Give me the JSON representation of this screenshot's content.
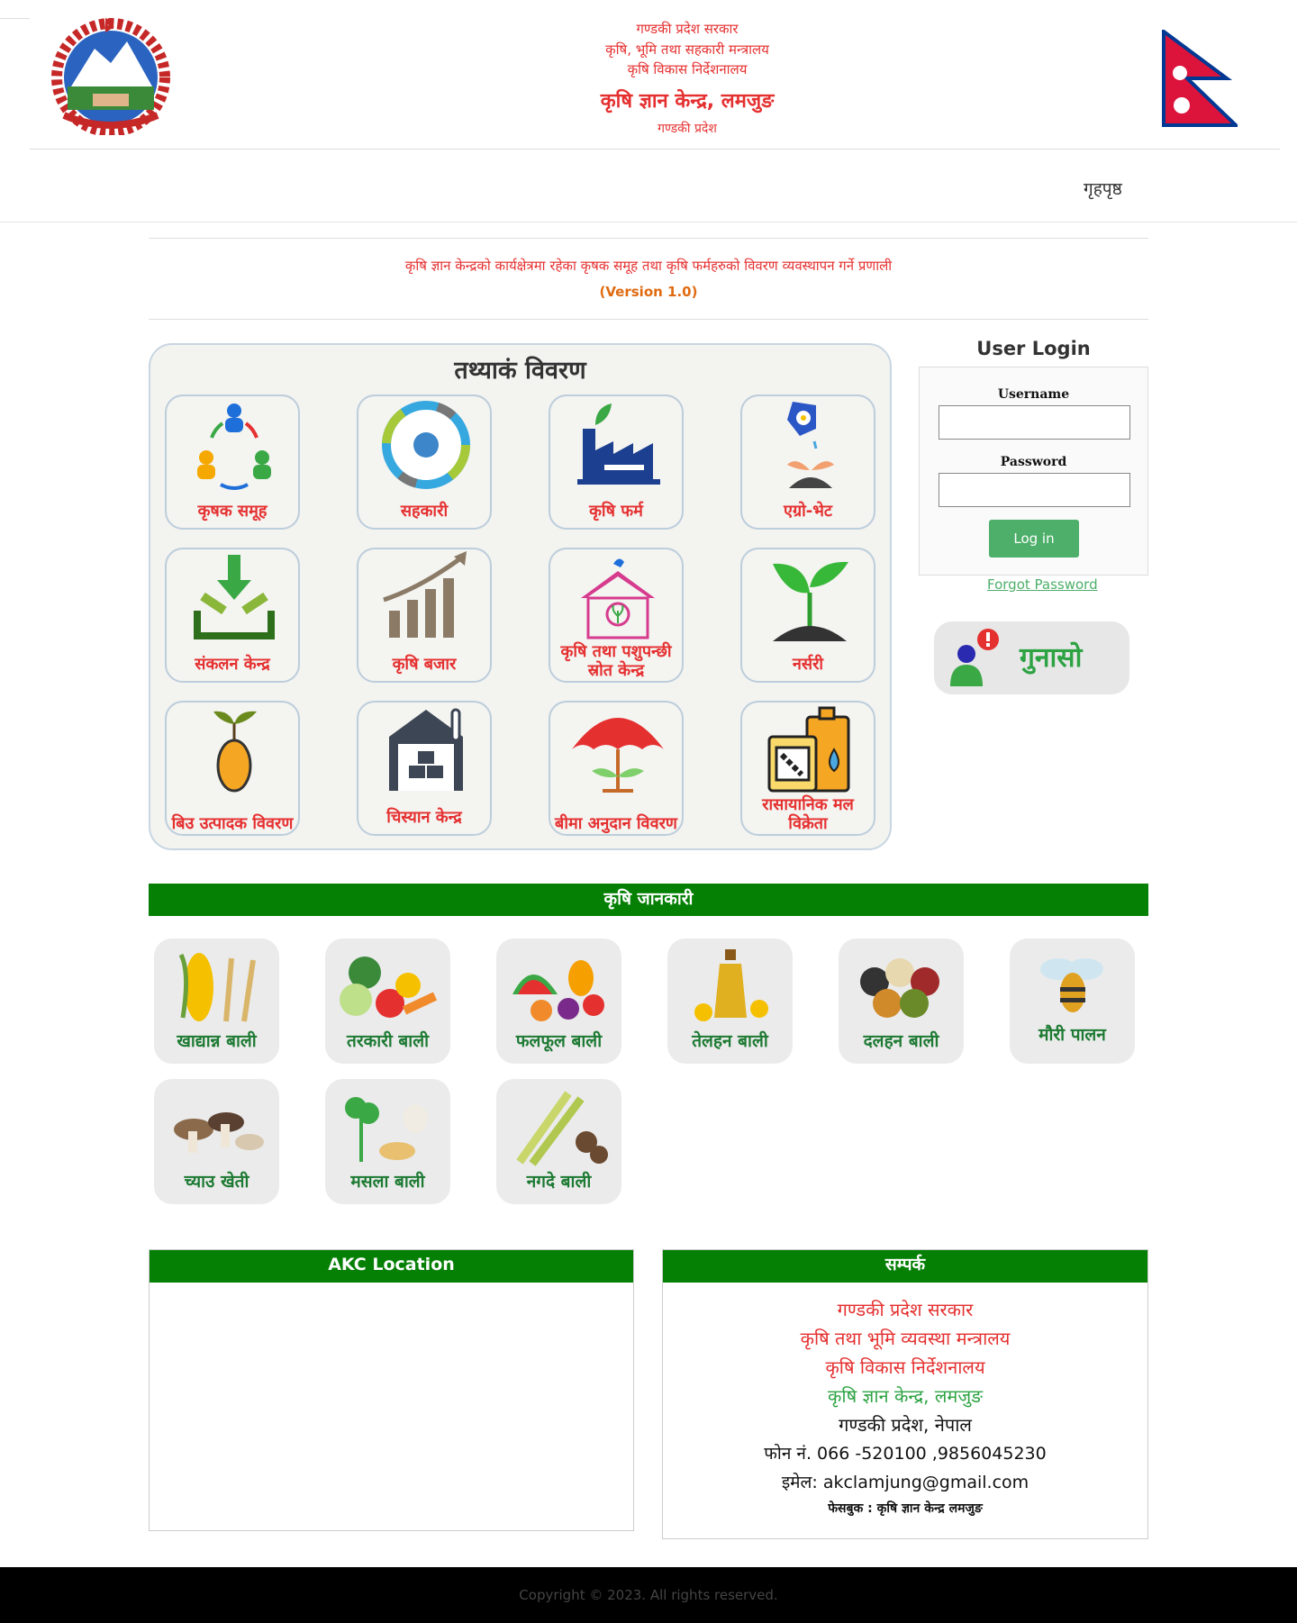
{
  "header": {
    "line1": "गण्डकी प्रदेश सरकार",
    "line2": "कृषि, भूमि तथा सहकारी मन्त्रालय",
    "line3": "कृषि विकास निर्देशनालय",
    "line4": "कृषि ज्ञान केन्द्र, लमजुङ",
    "line5": "गण्डकी प्रदेश"
  },
  "nav": {
    "home": "गृहपृष्ठ"
  },
  "app": {
    "title": "कृषि ज्ञान केन्द्रको कार्यक्षेत्रमा रहेका कृषक समूह तथा कृषि फर्महरुको विवरण व्यवस्थापन गर्ने प्रणाली",
    "version": "(Version 1.0)"
  },
  "stats": {
    "title": "तथ्याकं विवरण",
    "cards": [
      {
        "label": "कृषक समूह",
        "icon": "farmer-group-icon"
      },
      {
        "label": "सहकारी",
        "icon": "cooperative-icon"
      },
      {
        "label": "कृषि फर्म",
        "icon": "farm-factory-icon"
      },
      {
        "label": "एग्रो-भेट",
        "icon": "agrovet-icon"
      },
      {
        "label": "संकलन केन्द्र",
        "icon": "collection-center-icon"
      },
      {
        "label": "कृषि बजार",
        "icon": "market-chart-icon"
      },
      {
        "label": "कृषि तथा पशुपन्छी स्रोत केन्द्र",
        "icon": "resource-center-icon"
      },
      {
        "label": "नर्सरी",
        "icon": "nursery-sprout-icon"
      },
      {
        "label": "बिउ उत्पादक विवरण",
        "icon": "seed-icon"
      },
      {
        "label": "चिस्यान केन्द्र",
        "icon": "cold-storage-icon"
      },
      {
        "label": "बीमा अनुदान विवरण",
        "icon": "insurance-umbrella-icon"
      },
      {
        "label": "रासायानिक मल विक्रेता",
        "icon": "fertilizer-icon"
      }
    ]
  },
  "login": {
    "title": "User Login",
    "username_label": "Username",
    "password_label": "Password",
    "button": "Log in",
    "forgot": "Forgot Password"
  },
  "gunaso": {
    "label": "गुनासो"
  },
  "krishi": {
    "title": "कृषि जानकारी",
    "items": [
      {
        "label": "खाद्यान्न बाली",
        "icon": "cereal-crops-icon"
      },
      {
        "label": "तरकारी बाली",
        "icon": "vegetables-icon"
      },
      {
        "label": "फलफूल बाली",
        "icon": "fruits-icon"
      },
      {
        "label": "तेलहन बाली",
        "icon": "oilseed-icon"
      },
      {
        "label": "दलहन बाली",
        "icon": "pulses-icon"
      },
      {
        "label": "मौरी पालन",
        "icon": "bee-icon"
      },
      {
        "label": "च्याउ खेती",
        "icon": "mushroom-icon"
      },
      {
        "label": "मसला बाली",
        "icon": "spices-icon"
      },
      {
        "label": "नगदे बाली",
        "icon": "cash-crop-icon"
      }
    ]
  },
  "location": {
    "title": "AKC Location"
  },
  "contact": {
    "title": "सम्पर्क",
    "l1": "गण्डकी प्रदेश सरकार",
    "l2": "कृषि तथा भूमि व्यवस्था मन्त्रालय",
    "l3": "कृषि विकास निर्देशनालय",
    "l4": "कृषि ज्ञान केन्द्र, लमजुङ",
    "l5": "गण्डकी प्रदेश, नेपाल",
    "phone": "फोन नं. 066 -520100 ,9856045230",
    "email": "इमेल: akclamjung@gmail.com",
    "facebook": "फेसबुक : कृषि ज्ञान केन्द्र लमजुङ"
  },
  "footer": {
    "copyright": "Copyright © 2023. All rights reserved."
  },
  "colors": {
    "red": "#e53030",
    "green_bar": "#058005",
    "green_text": "#1d7a33",
    "button_green": "#4daf6a"
  }
}
